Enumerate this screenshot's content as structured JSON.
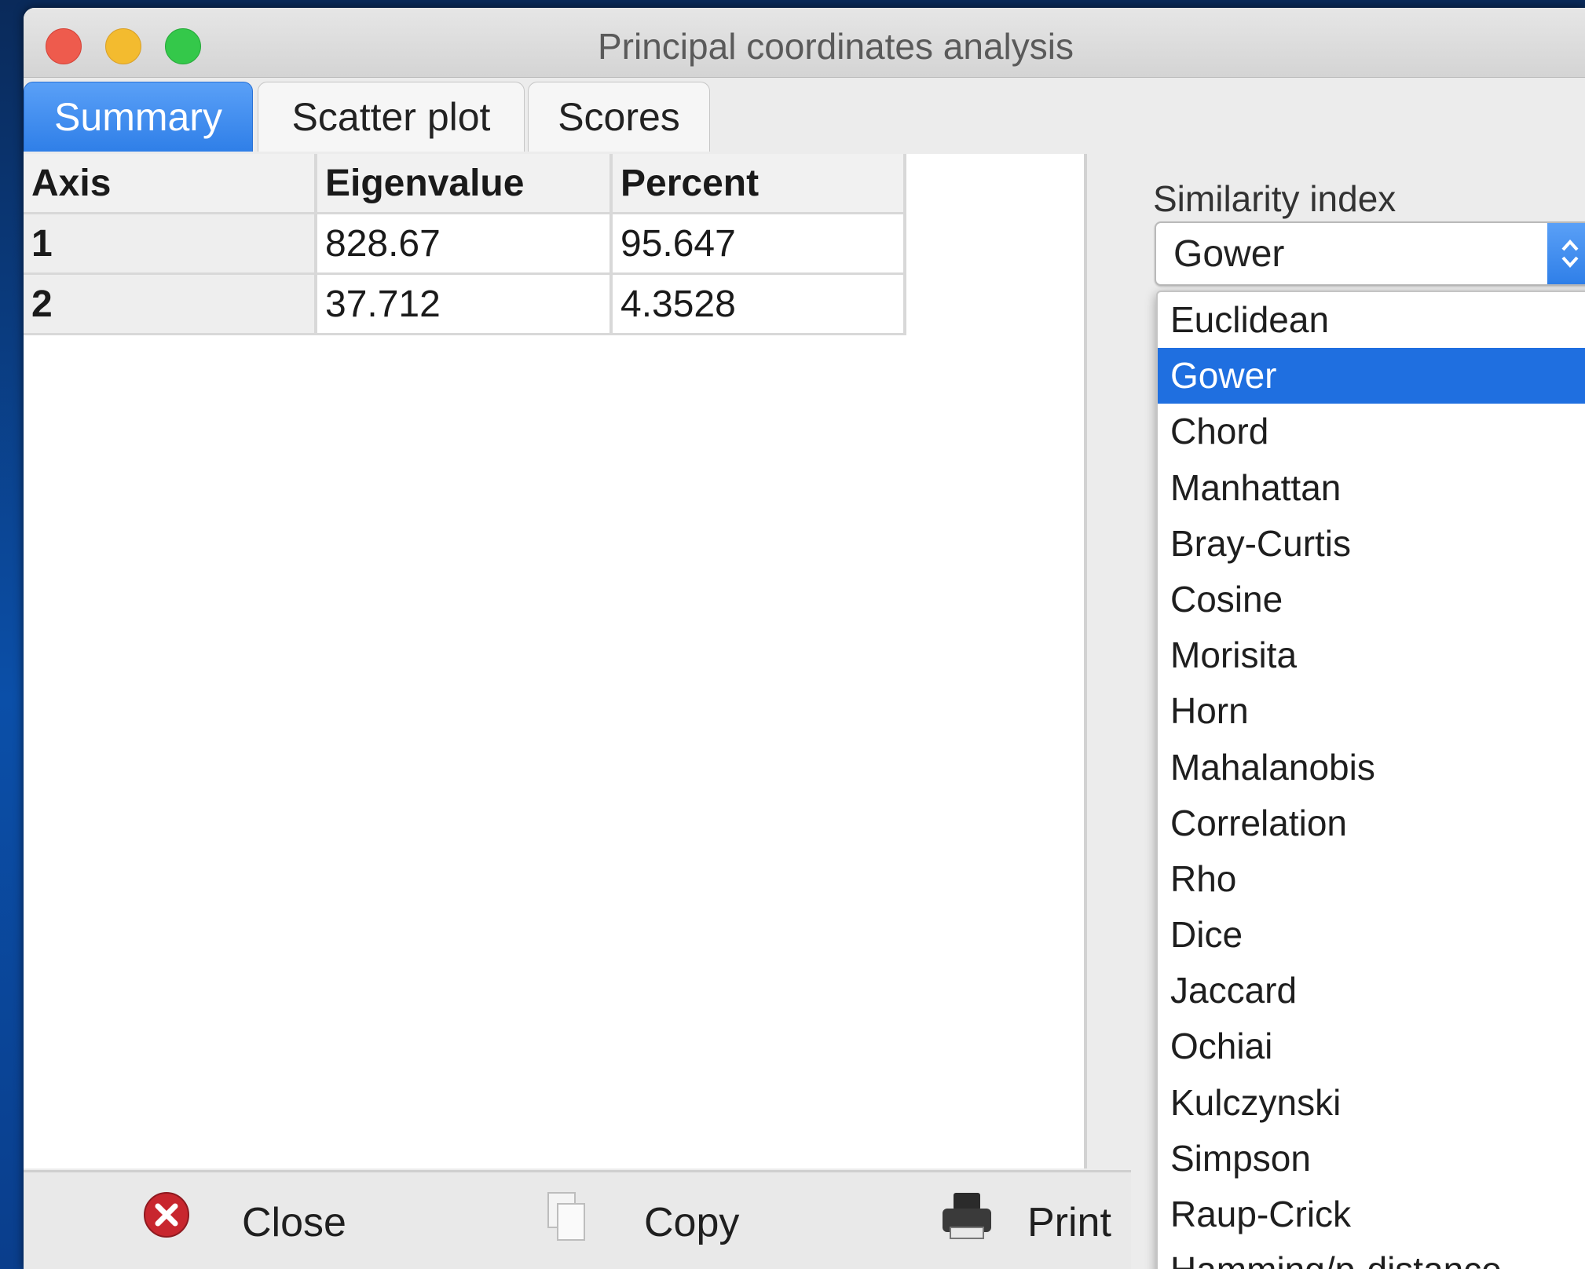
{
  "window": {
    "title": "Principal coordinates analysis"
  },
  "tabs": [
    {
      "label": "Summary",
      "active": true
    },
    {
      "label": "Scatter plot",
      "active": false
    },
    {
      "label": "Scores",
      "active": false
    }
  ],
  "summary_table": {
    "headers": [
      "Axis",
      "Eigenvalue",
      "Percent"
    ],
    "rows": [
      [
        "1",
        "828.67",
        "95.647"
      ],
      [
        "2",
        "37.712",
        "4.3528"
      ]
    ]
  },
  "similarity": {
    "label": "Similarity index",
    "selected": "Gower",
    "options": [
      "Euclidean",
      "Gower",
      "Chord",
      "Manhattan",
      "Bray-Curtis",
      "Cosine",
      "Morisita",
      "Horn",
      "Mahalanobis",
      "Correlation",
      "Rho",
      "Dice",
      "Jaccard",
      "Ochiai",
      "Kulczynski",
      "Simpson",
      "Raup-Crick",
      "Hamming/p-distance"
    ]
  },
  "buttons": {
    "close": "Close",
    "copy": "Copy",
    "print": "Print"
  },
  "colors": {
    "accent": "#2f7fe8",
    "selected_option": "#1f6fe0",
    "close_icon": "#c8262e"
  },
  "icons": {
    "close": "close-circle-icon",
    "copy": "copy-document-icon",
    "print": "printer-icon",
    "select": "chevron-updown-icon"
  }
}
